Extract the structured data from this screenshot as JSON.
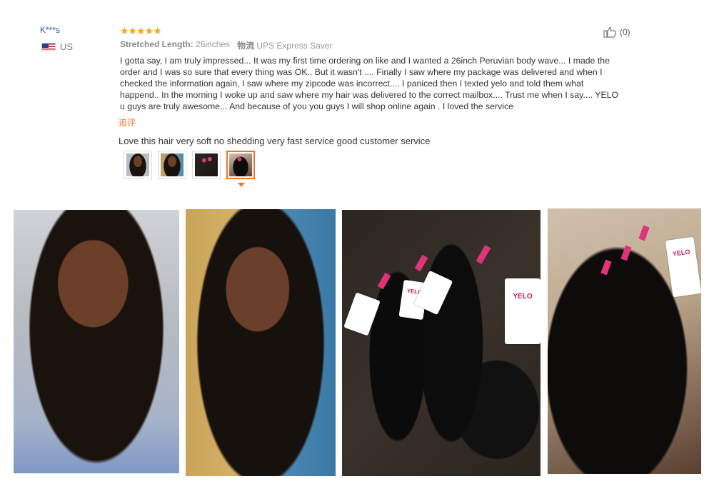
{
  "review": {
    "reviewer_name": "K***s",
    "country": "US",
    "stars": "★★★★★",
    "meta_label": "Stretched Length:",
    "meta_value": "26inches",
    "shipping_label": "物流",
    "shipping_value": "UPS Express Saver",
    "helpful_count": "(0)",
    "text_lines": [
      "I gotta say, I am truly impressed... It was my first time ordering on like and I wanted a 26inch Peruvian body wave... I made the",
      "order and I was so sure that every thing was OK.. But it wasn't .... Finally I saw where my package was delivered and when I",
      "checked the information again, I saw where my zipcode was incorrect.... I paniced then I texted yelo and told them what",
      "happend.. In the morning I woke up and saw where my hair was delivered to the correct mailbox.... Trust me when I say.... YELO",
      "u guys are truly awesome... And because of you you guys I will shop online again . I loved the service"
    ],
    "followup_label": "追评",
    "followup_text": "Love this hair very soft no shedding very fast service good customer service"
  },
  "photo_tags": {
    "brand": "YELO"
  },
  "colors": {
    "accent": "#f57224",
    "stars": "#f5a623",
    "reviewer_link": "#2a5aa7"
  }
}
